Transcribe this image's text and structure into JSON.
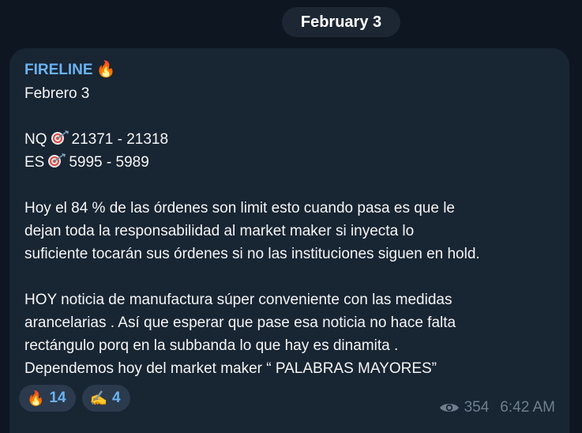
{
  "date_pill": "February 3",
  "message": {
    "sender": "FIRELINE",
    "sender_emoji": "🔥",
    "lines": [
      {
        "text": "Febrero 3"
      },
      {
        "text": ""
      },
      {
        "prefix": "NQ",
        "icon": "target-dart-icon",
        "suffix": "21371 - 21318"
      },
      {
        "prefix": "ES",
        "icon": "target-dart-icon",
        "suffix": "5995 - 5989"
      },
      {
        "text": ""
      },
      {
        "text": "Hoy el 84 % de las órdenes son limit esto cuando pasa es que le"
      },
      {
        "text": "dejan toda la responsabilidad al market maker si inyecta lo"
      },
      {
        "text": "suficiente tocarán sus órdenes si no las instituciones siguen en hold."
      },
      {
        "text": ""
      },
      {
        "text": "HOY noticia de manufactura súper conveniente con las medidas"
      },
      {
        "text": "arancelarias . Así que esperar que pase esa noticia no hace falta"
      },
      {
        "text": "rectángulo porq en la subbanda lo que hay es dinamita ."
      },
      {
        "text": "Dependemos hoy del market maker “ PALABRAS MAYORES”"
      }
    ],
    "reactions": [
      {
        "emoji": "🔥",
        "count": "14"
      },
      {
        "emoji": "✍️",
        "count": "4"
      }
    ],
    "views": "354",
    "time": "6:42 AM"
  },
  "colors": {
    "background": "#0e1621",
    "bubble": "#182533",
    "accent": "#6ab3f3",
    "meta": "#6d7f8f"
  }
}
